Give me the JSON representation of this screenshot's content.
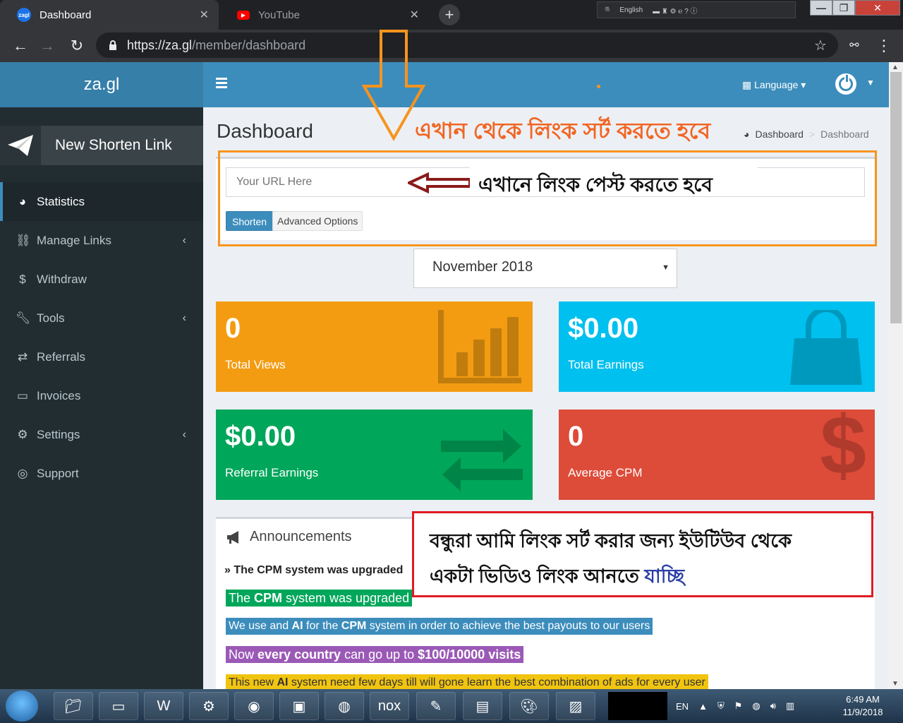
{
  "browser": {
    "tabs": [
      {
        "title": "Dashboard",
        "favicon": "za.gl-favicon"
      },
      {
        "title": "YouTube",
        "favicon": "youtube-favicon"
      }
    ],
    "url_host": "https://za.gl",
    "url_path": "/member/dashboard",
    "lang_indicator": "English"
  },
  "sidebar": {
    "logo": "za.gl",
    "new_link": "New Shorten Link",
    "items": [
      {
        "label": "Statistics",
        "icon": "dashboard-icon",
        "active": true
      },
      {
        "label": "Manage Links",
        "icon": "link-icon",
        "submenu": true
      },
      {
        "label": "Withdraw",
        "icon": "dollar-icon"
      },
      {
        "label": "Tools",
        "icon": "wrench-icon",
        "submenu": true
      },
      {
        "label": "Referrals",
        "icon": "exchange-icon"
      },
      {
        "label": "Invoices",
        "icon": "credit-card-icon"
      },
      {
        "label": "Settings",
        "icon": "gears-icon",
        "submenu": true
      },
      {
        "label": "Support",
        "icon": "lifebuoy-icon"
      }
    ]
  },
  "header": {
    "language": "Language"
  },
  "main": {
    "title": "Dashboard",
    "breadcrumb": [
      "Dashboard",
      "Dashboard"
    ],
    "url_placeholder": "Your URL Here",
    "shorten_label": "Shorten",
    "advanced_label": "Advanced Options",
    "month": "November 2018",
    "stats": {
      "views_value": "0",
      "views_label": "Total Views",
      "earnings_value": "$0.00",
      "earnings_label": "Total Earnings",
      "referral_value": "$0.00",
      "referral_label": "Referral Earnings",
      "cpm_value": "0",
      "cpm_label": "Average CPM"
    }
  },
  "announcements": {
    "title": "Announcements",
    "heading": "The CPM system was upgraded",
    "lines": [
      {
        "parts": [
          [
            "The ",
            false
          ],
          [
            "CPM",
            true
          ],
          [
            " system was upgraded",
            false
          ]
        ],
        "color": "#00a65a",
        "size": 18
      },
      {
        "parts": [
          [
            "We use and ",
            false
          ],
          [
            "AI",
            true
          ],
          [
            " for the ",
            false
          ],
          [
            "CPM",
            true
          ],
          [
            " system in order to achieve the best payouts to our users",
            false
          ]
        ],
        "color": "#3c8dbc",
        "size": 16
      },
      {
        "parts": [
          [
            "Now ",
            false
          ],
          [
            "every country",
            true
          ],
          [
            " can go up to ",
            false
          ],
          [
            "$100/10000 visits",
            true
          ]
        ],
        "color": "#9b59b6",
        "size": 18
      },
      {
        "parts": [
          [
            "This new ",
            false
          ],
          [
            "AI",
            true
          ],
          [
            " system need few days till will gone learn the best combination of ads for every user",
            false
          ]
        ],
        "color": "#f1c40f",
        "size": 16,
        "text_color": "#333"
      }
    ]
  },
  "annotations": {
    "top_note": "এখান থেকে লিংক সর্ট করতে হবে",
    "paste_note": "এখানে লিংক পেস্ট করতে হবে",
    "red_note_line1": "বন্ধুরা আমি লিংক সর্ট করার জন্য ইউটিউব থেকে",
    "red_note_line2": "একটা ভিডিও লিংক আনতে",
    "red_note_blue": "যাচ্ছি"
  },
  "taskbar": {
    "lang": "EN",
    "time": "6:49 AM",
    "date": "11/9/2018"
  }
}
